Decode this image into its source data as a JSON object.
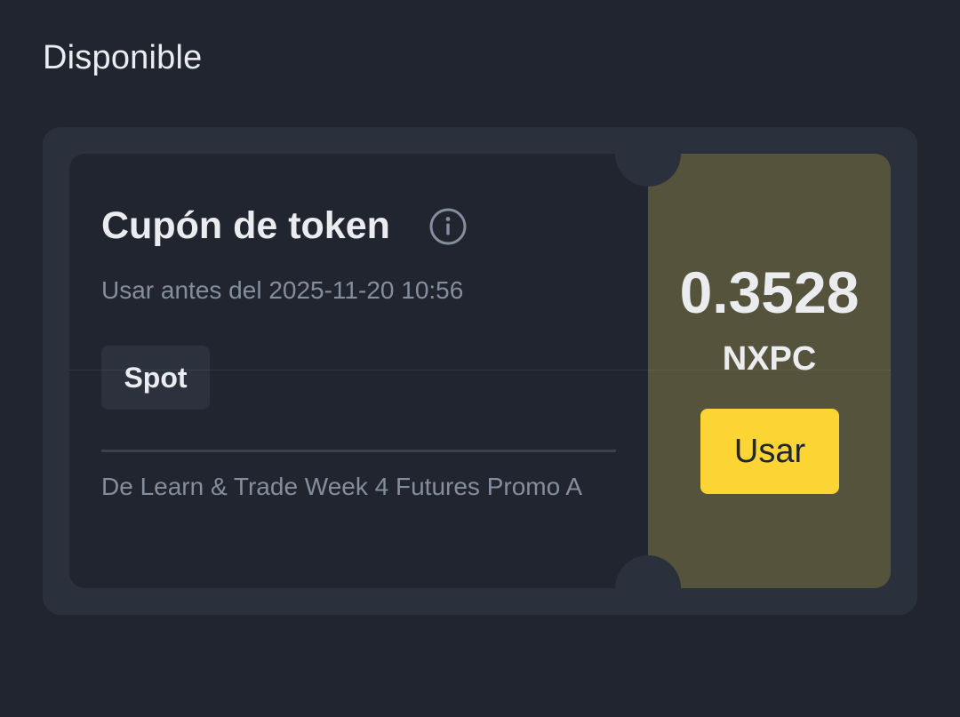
{
  "section": {
    "title": "Disponible"
  },
  "coupon": {
    "title": "Cupón de token",
    "expiry": "Usar antes del 2025-11-20 10:56",
    "tag": "Spot",
    "source": "De Learn & Trade Week 4 Futures Promo A",
    "amount": "0.3528",
    "currency": "NXPC",
    "use_label": "Usar",
    "info_icon": "info-circle-icon",
    "colors": {
      "background": "#202530",
      "card": "#2a303c",
      "right_panel": "#55533b",
      "accent": "#fcd535",
      "text_primary": "#eaecef",
      "text_secondary": "#848e9c"
    }
  }
}
